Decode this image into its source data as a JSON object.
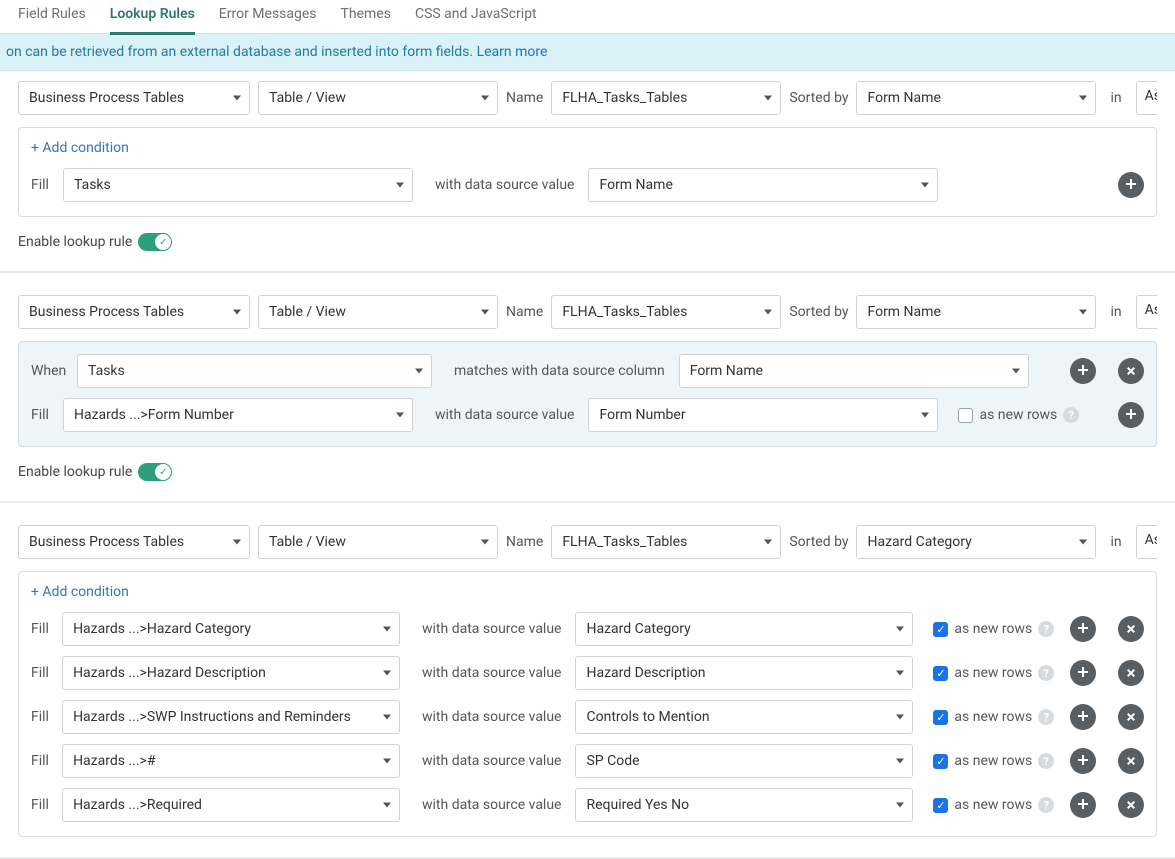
{
  "tabs": {
    "items": [
      {
        "label": "Field Rules",
        "active": false
      },
      {
        "label": "Lookup Rules",
        "active": true
      },
      {
        "label": "Error Messages",
        "active": false
      },
      {
        "label": "Themes",
        "active": false
      },
      {
        "label": "CSS and JavaScript",
        "active": false
      }
    ]
  },
  "banner": {
    "text": "on can be retrieved from an external database and inserted into form fields. ",
    "link": "Learn more"
  },
  "labels": {
    "name": "Name",
    "sorted_by": "Sorted by",
    "in": "in",
    "add_condition": "+ Add condition",
    "fill": "Fill",
    "when": "When",
    "with_value": "with data source value",
    "matches_column": "matches with data source column",
    "as_new_rows": "as new rows",
    "enable_rule": "Enable lookup rule",
    "asc_cut": "As"
  },
  "rules": [
    {
      "source": "Business Process Tables",
      "tableview": "Table / View",
      "name": "FLHA_Tasks_Tables",
      "sorted_by": "Form Name",
      "add_condition": true,
      "condition_shaded": false,
      "fills": [
        {
          "field": "Tasks",
          "value": "Form Name",
          "as_new_rows": null,
          "show_remove": false
        }
      ],
      "enable": true
    },
    {
      "source": "Business Process Tables",
      "tableview": "Table / View",
      "name": "FLHA_Tasks_Tables",
      "sorted_by": "Form Name",
      "add_condition": false,
      "condition_shaded": true,
      "when": {
        "field": "Tasks",
        "column": "Form Name"
      },
      "fills": [
        {
          "field": "Hazards ...>Form Number",
          "value": "Form Number",
          "as_new_rows": false,
          "show_remove": false
        }
      ],
      "enable": true
    },
    {
      "source": "Business Process Tables",
      "tableview": "Table / View",
      "name": "FLHA_Tasks_Tables",
      "sorted_by": "Hazard Category",
      "add_condition": true,
      "condition_shaded": false,
      "fills": [
        {
          "field": "Hazards ...>Hazard Category",
          "value": "Hazard Category",
          "as_new_rows": true,
          "show_remove": true
        },
        {
          "field": "Hazards ...>Hazard Description",
          "value": "Hazard Description",
          "as_new_rows": true,
          "show_remove": true
        },
        {
          "field": "Hazards ...>SWP Instructions and Reminders",
          "value": "Controls to Mention",
          "as_new_rows": true,
          "show_remove": true
        },
        {
          "field": "Hazards ...>#",
          "value": "SP Code",
          "as_new_rows": true,
          "show_remove": true
        },
        {
          "field": "Hazards ...>Required",
          "value": "Required Yes No",
          "as_new_rows": true,
          "show_remove": true
        }
      ],
      "enable": null
    }
  ]
}
